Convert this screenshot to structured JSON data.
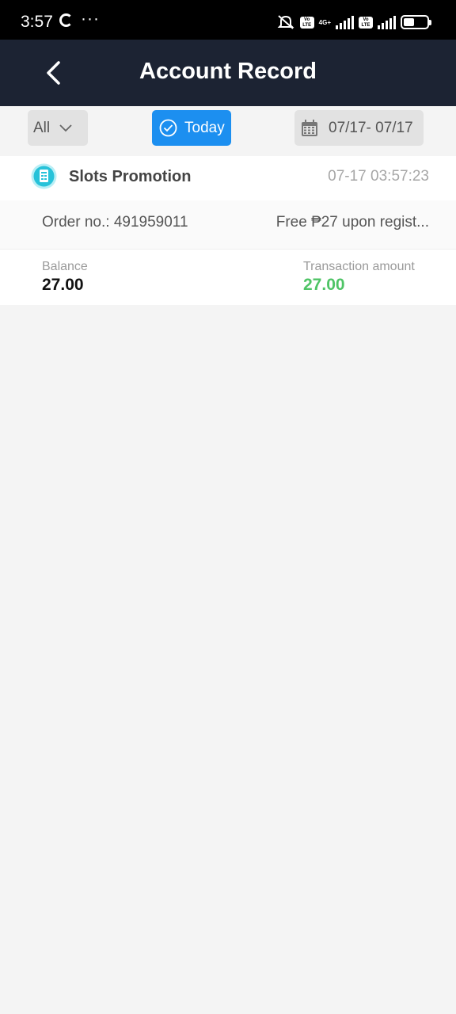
{
  "status_bar": {
    "time": "3:57",
    "dots": "···",
    "volte1": "Vo LTE",
    "network": "4G+",
    "volte2": "Vo LTE",
    "battery_percent": 45
  },
  "header": {
    "title": "Account Record"
  },
  "filters": {
    "type_label": "All",
    "today_label": "Today",
    "date_range": "07/17- 07/17"
  },
  "records": [
    {
      "type": "Slots Promotion",
      "time": "07-17 03:57:23",
      "order_no": "Order no.: 491959011",
      "description": "Free ₱27 upon regist...",
      "balance_label": "Balance",
      "balance": "27.00",
      "amount_label": "Transaction amount",
      "amount": "27.00"
    }
  ],
  "colors": {
    "header_bg": "#1c2333",
    "accent": "#1c8ff0",
    "positive": "#4fc466",
    "promo_icon": "#27c2d9"
  }
}
